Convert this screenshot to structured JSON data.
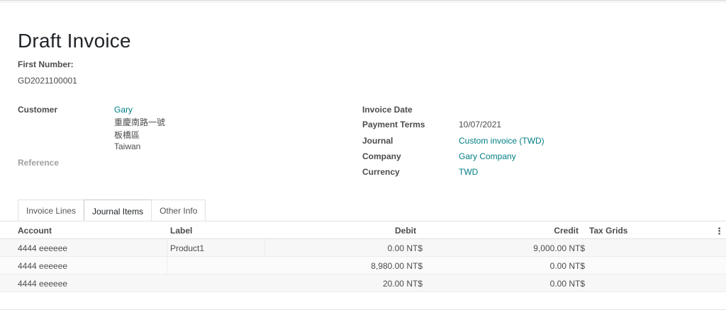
{
  "invoice": {
    "title": "Draft Invoice",
    "first_number_label": "First Number:",
    "first_number": "GD2021100001"
  },
  "left_fields": {
    "customer_label": "Customer",
    "customer_name": "Gary",
    "address_line1": "重慶南路一號",
    "address_line2": "板橋區",
    "address_line3": "Taiwan",
    "reference_label": "Reference"
  },
  "right_fields": {
    "invoice_date_label": "Invoice Date",
    "invoice_date_value": "",
    "payment_terms_label": "Payment Terms",
    "payment_terms_value": "10/07/2021",
    "journal_label": "Journal",
    "journal_value": "Custom invoice (TWD)",
    "company_label": "Company",
    "company_value": "Gary Company",
    "currency_label": "Currency",
    "currency_value": "TWD"
  },
  "tabs": [
    {
      "label": "Invoice Lines",
      "active": false
    },
    {
      "label": "Journal Items",
      "active": true
    },
    {
      "label": "Other Info",
      "active": false
    }
  ],
  "table": {
    "headers": {
      "account": "Account",
      "label": "Label",
      "debit": "Debit",
      "credit": "Credit",
      "tax_grids": "Tax Grids",
      "options": "⋮"
    },
    "rows": [
      {
        "account": "4444 eeeeee",
        "label": "Product1",
        "debit": "0.00 NT$",
        "credit": "9,000.00 NT$"
      },
      {
        "account": "4444 eeeeee",
        "label": "",
        "debit": "8,980.00 NT$",
        "credit": "0.00 NT$"
      },
      {
        "account": "4444 eeeeee",
        "label": "",
        "debit": "20.00 NT$",
        "credit": "0.00 NT$"
      }
    ]
  }
}
